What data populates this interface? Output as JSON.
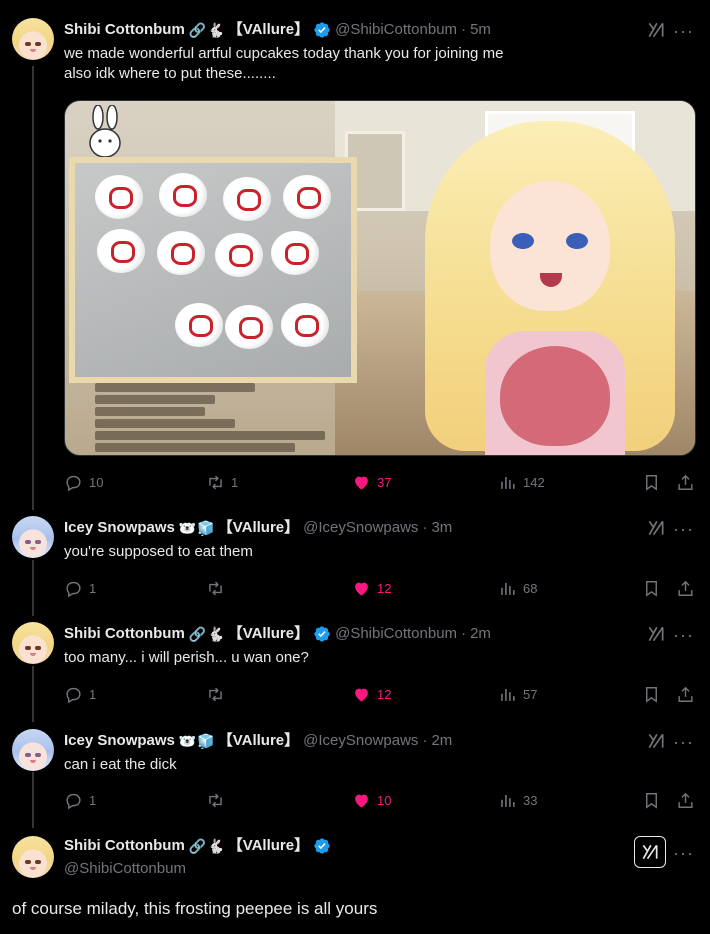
{
  "colors": {
    "background": "#000000",
    "text": "#e7e9ea",
    "muted": "#71767b",
    "like": "#f91880",
    "verified": "#1d9bf0",
    "thread_line": "#333639"
  },
  "tweets": [
    {
      "name": "Shibi Cottonbum",
      "emojis": "🔗🐇",
      "tag": "【VAllure】",
      "verified": true,
      "handle": "@ShibiCottonbum",
      "dot": "·",
      "time": "5m",
      "text_line1": "we made wonderful artful cupcakes today thank you for joining me",
      "text_line2": "also idk where to put these........",
      "replies": "10",
      "reposts": "1",
      "likes": "37",
      "views": "142"
    },
    {
      "name": "Icey Snowpaws",
      "emojis": "🐻‍❄️🧊",
      "tag": "【VAllure】",
      "verified": false,
      "handle": "@IceySnowpaws",
      "dot": "·",
      "time": "3m",
      "text": "you're supposed to eat them",
      "replies": "1",
      "reposts": "",
      "likes": "12",
      "views": "68"
    },
    {
      "name": "Shibi Cottonbum",
      "emojis": "🔗🐇",
      "tag": "【VAllure】",
      "verified": true,
      "handle": "@ShibiCottonbum",
      "dot": "·",
      "time": "2m",
      "text": "too many... i will perish... u wan one?",
      "replies": "1",
      "reposts": "",
      "likes": "12",
      "views": "57"
    },
    {
      "name": "Icey Snowpaws",
      "emojis": "🐻‍❄️🧊",
      "tag": "【VAllure】",
      "verified": false,
      "handle": "@IceySnowpaws",
      "dot": "·",
      "time": "2m",
      "text": "can i eat the dick",
      "replies": "1",
      "reposts": "",
      "likes": "10",
      "views": "33"
    },
    {
      "name": "Shibi Cottonbum",
      "emojis": "🔗🐇",
      "tag": "【VAllure】",
      "verified": true,
      "handle": "@ShibiCottonbum",
      "text": "of course milady, this frosting peepee is all yours"
    }
  ],
  "icons": {
    "reply": "reply-icon",
    "repost": "repost-icon",
    "like": "heart-icon",
    "views": "views-icon",
    "bookmark": "bookmark-icon",
    "share": "share-icon",
    "grok": "grok-icon",
    "more": "more-icon",
    "verified": "verified-badge-icon"
  },
  "more_glyph": "···"
}
